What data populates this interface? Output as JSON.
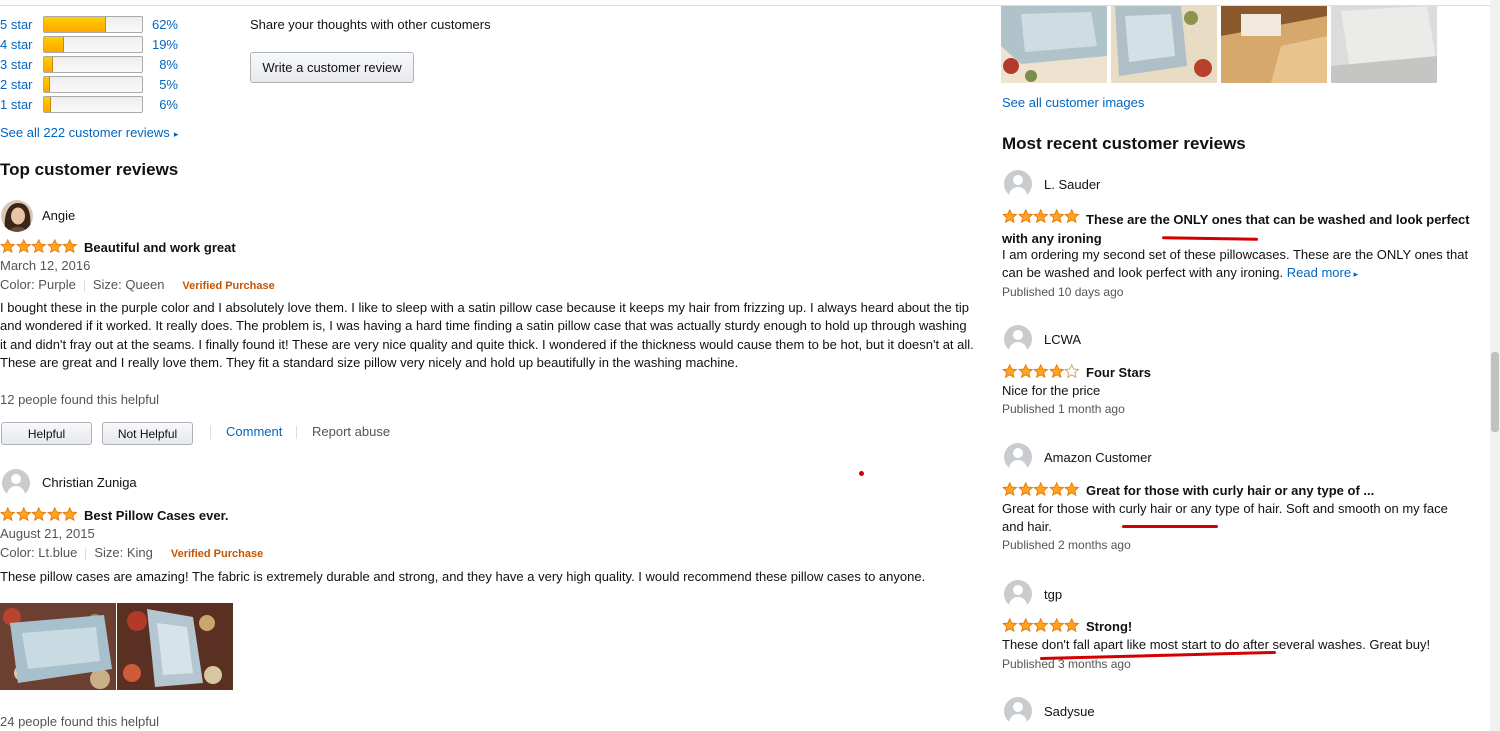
{
  "histogram": [
    {
      "label": "5 star",
      "percent": "62%",
      "fill": 0.62
    },
    {
      "label": "4 star",
      "percent": "19%",
      "fill": 0.19
    },
    {
      "label": "3 star",
      "percent": "8%",
      "fill": 0.08
    },
    {
      "label": "2 star",
      "percent": "5%",
      "fill": 0.05
    },
    {
      "label": "1 star",
      "percent": "6%",
      "fill": 0.06
    }
  ],
  "see_all_reviews": "See all 222 customer reviews",
  "share_text": "Share your thoughts with other customers",
  "write_review_label": "Write a customer review",
  "top_reviews_heading": "Top customer reviews",
  "reviews": [
    {
      "author": "Angie",
      "rating": 5,
      "title": "Beautiful and work great",
      "date": "March 12, 2016",
      "color": "Color: Purple",
      "size": "Size: Queen",
      "verified": "Verified Purchase",
      "body": "I bought these in the purple color and I absolutely love them. I like to sleep with a satin pillow case because it keeps my hair from frizzing up. I always heard about the tip and wondered if it worked. It really does. The problem is, I was having a hard time finding a satin pillow case that was actually sturdy enough to hold up through washing it and didn't fray out at the seams. I finally found it! These are very nice quality and quite thick. I wondered if the thickness would cause them to be hot, but it doesn't at all. These are great and I really love them. They fit a standard size pillow very nicely and hold up beautifully in the washing machine.",
      "helpful_count": "12 people found this helpful",
      "helpful_label": "Helpful",
      "not_helpful_label": "Not Helpful",
      "comment_label": "Comment",
      "report_label": "Report abuse"
    },
    {
      "author": "Christian Zuniga",
      "rating": 5,
      "title": "Best Pillow Cases ever.",
      "date": "August 21, 2015",
      "color": "Color: Lt.blue",
      "size": "Size: King",
      "verified": "Verified Purchase",
      "body": "These pillow cases are amazing! The fabric is extremely durable and strong, and they have a very high quality. I would recommend these pillow cases to anyone.",
      "helpful_count": "24 people found this helpful"
    }
  ],
  "see_all_images": "See all customer images",
  "recent_heading": "Most recent customer reviews",
  "recent": [
    {
      "author": "L. Sauder",
      "rating": 5,
      "title": "These are the ONLY ones that can be washed and look perfect with any ironing",
      "body": "I am ordering my second set of these pillowcases. These are the ONLY ones that can be washed and look perfect with any ironing.",
      "read_more": "Read more",
      "published": "Published 10 days ago"
    },
    {
      "author": "LCWA",
      "rating": 4,
      "title": "Four Stars",
      "body": "Nice for the price",
      "published": "Published 1 month ago"
    },
    {
      "author": "Amazon Customer",
      "rating": 5,
      "title": "Great for those with curly hair or any type of ...",
      "body": "Great for those with curly hair or any type of hair. Soft and smooth on my face and hair.",
      "published": "Published 2 months ago"
    },
    {
      "author": "tgp",
      "rating": 5,
      "title": "Strong!",
      "body": "These don't fall apart like most start to do after several washes. Great buy!",
      "published": "Published 3 months ago"
    },
    {
      "author": "Sadysue"
    }
  ],
  "colors": {
    "link": "#0066c0",
    "star": "#ffa41c",
    "verified": "#c45500",
    "annotation": "#d40000"
  }
}
